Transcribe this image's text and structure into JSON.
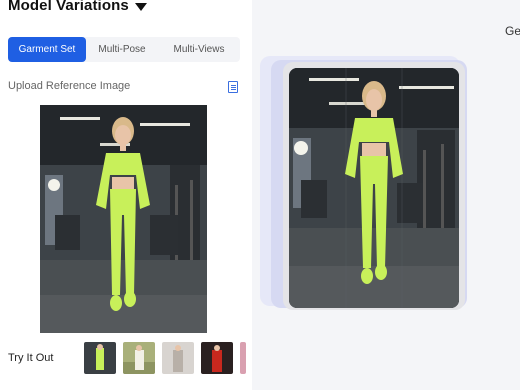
{
  "header": {
    "title": "Model Variations"
  },
  "tabs": [
    {
      "label": "Garment Set",
      "active": true
    },
    {
      "label": "Multi-Pose",
      "active": false
    },
    {
      "label": "Multi-Views",
      "active": false
    }
  ],
  "upload": {
    "label": "Upload Reference Image"
  },
  "try_it_out": {
    "label": "Try It Out"
  },
  "preview": {
    "corner_text": "Ge"
  },
  "colors": {
    "accent": "#1f5fe3",
    "outfit": "#c8f05a",
    "panel_bg": "#f4f5f8"
  }
}
